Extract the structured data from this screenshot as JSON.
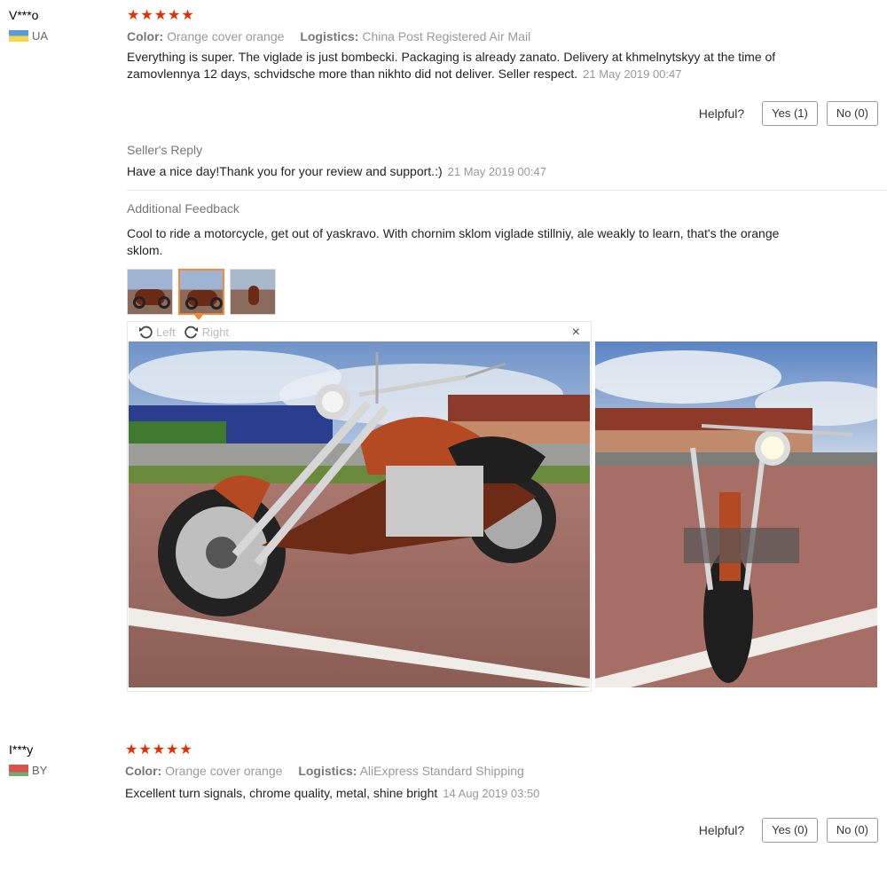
{
  "reviews": [
    {
      "user": "V***o",
      "country": "UA",
      "stars": "★★★★★",
      "color_label": "Color:",
      "color_value": "Orange cover orange",
      "logistics_label": "Logistics:",
      "logistics_value": "China Post Registered Air Mail",
      "text": "Everything is super. The viglade is just bombecki. Packaging is already zanato. Delivery at khmelnytskyy at the time of zamovlennya 12 days, schvidsche more than nikhto did not deliver. Seller respect.",
      "date": "21 May 2019 00:47",
      "helpful_label": "Helpful?",
      "yes_label": "Yes (1)",
      "no_label": "No (0)",
      "seller_reply_title": "Seller's Reply",
      "seller_reply_text": "Have a nice day!Thank you for your review and support.:)",
      "seller_reply_date": "21 May 2019 00:47",
      "additional_title": "Additional Feedback",
      "additional_text": "Cool to ride a motorcycle, get out of yaskravo. With chornim sklom viglade stillniy, ale weakly to learn, that's the orange sklom.",
      "viewer": {
        "left_label": "Left",
        "right_label": "Right",
        "close": "×"
      }
    },
    {
      "user": "I***y",
      "country": "BY",
      "stars": "★★★★★",
      "color_label": "Color:",
      "color_value": "Orange cover orange",
      "logistics_label": "Logistics:",
      "logistics_value": "AliExpress Standard Shipping",
      "text": "Excellent turn signals, chrome quality, metal, shine bright",
      "date": "14 Aug 2019 03:50",
      "helpful_label": "Helpful?",
      "yes_label": "Yes (0)",
      "no_label": "No (0)"
    }
  ],
  "colors": {
    "star": "#e62e04",
    "thumb_active": "#f08a3c"
  },
  "icons": {
    "rotate_left": "rotate-left-icon",
    "rotate_right": "rotate-right-icon",
    "close": "close-icon"
  }
}
